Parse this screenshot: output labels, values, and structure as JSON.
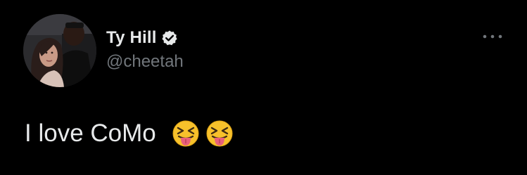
{
  "tweet": {
    "display_name": "Ty Hill",
    "handle": "@cheetah",
    "verified": true,
    "text": "I love CoMo",
    "emojis": [
      "squinting-face-with-tongue",
      "squinting-face-with-tongue"
    ],
    "more_icon": "more-horizontal-icon"
  },
  "colors": {
    "background": "#000000",
    "name": "#e7e9ea",
    "handle": "#71767b",
    "verified": "#e7e9ea"
  }
}
